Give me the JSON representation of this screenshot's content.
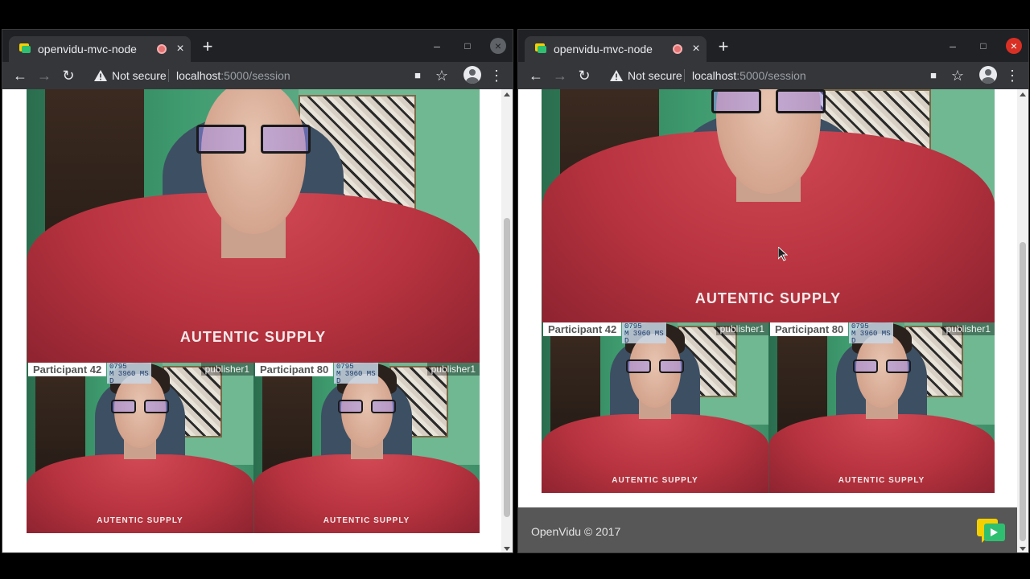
{
  "windows": [
    {
      "tab": {
        "title": "openvidu-mvc-node",
        "close": "×"
      },
      "new_tab": "+",
      "controls": {
        "minimize": "–",
        "maximize": "□",
        "close": "×"
      },
      "toolbar": {
        "back": "←",
        "forward": "→",
        "reload": "↻",
        "security": "Not secure",
        "url_host": "localhost",
        "url_path": ":5000/session",
        "camera": "■",
        "star": "☆",
        "menu": "⋮"
      },
      "main_video": {
        "hood_text": "AUTENTIC SUPPLY"
      },
      "participants": [
        {
          "name": "Participant 42",
          "stats": "0795\nM 3960 MS\nD",
          "role": "publisher1",
          "hood_text": "AUTENTIC SUPPLY"
        },
        {
          "name": "Participant 80",
          "stats": "0795\nM 3960 MS\nD",
          "role": "publisher1",
          "hood_text": "AUTENTIC SUPPLY"
        }
      ]
    },
    {
      "tab": {
        "title": "openvidu-mvc-node",
        "close": "×"
      },
      "new_tab": "+",
      "controls": {
        "minimize": "–",
        "maximize": "□",
        "close": "×"
      },
      "toolbar": {
        "back": "←",
        "forward": "→",
        "reload": "↻",
        "security": "Not secure",
        "url_host": "localhost",
        "url_path": ":5000/session",
        "camera": "■",
        "star": "☆",
        "menu": "⋮"
      },
      "main_video": {
        "hood_text": "AUTENTIC SUPPLY"
      },
      "participants": [
        {
          "name": "Participant 42",
          "stats": "0795\nM 3960 MS\nD",
          "role": "publisher1",
          "hood_text": "AUTENTIC SUPPLY"
        },
        {
          "name": "Participant 80",
          "stats": "0795\nM 3960 MS\nD",
          "role": "publisher1",
          "hood_text": "AUTENTIC SUPPLY"
        }
      ],
      "footer": {
        "copyright": "OpenVidu © 2017"
      }
    }
  ],
  "colors": {
    "chrome_dark": "#202124",
    "chrome_toolbar": "#35363a",
    "close_red": "#d93025",
    "footer_gray": "#575757",
    "openvidu_yellow": "#f5d000",
    "openvidu_green": "#2fbf71"
  },
  "icons": [
    "openvidu-favicon",
    "audio-playing-icon",
    "warning-icon",
    "camera-icon",
    "star-icon",
    "profile-icon",
    "menu-icon",
    "openvidu-logo"
  ]
}
